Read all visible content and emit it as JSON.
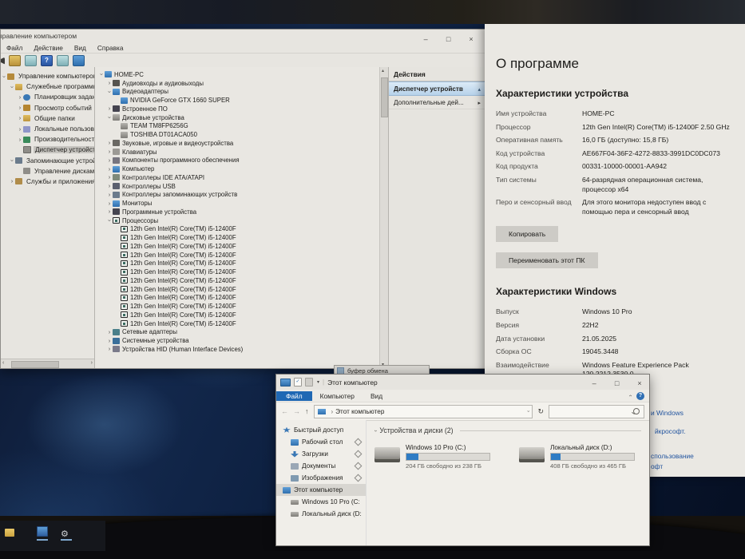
{
  "monitor": {
    "brand": "nulls"
  },
  "window_controls": {
    "minimize": "–",
    "maximize": "□",
    "close": "×"
  },
  "colors": {
    "accent": "#1f68b4",
    "link_blue": "#2456a0",
    "drive_bar": "#2f7cc4",
    "selection_blue": "#b7d2ea"
  },
  "computer_management": {
    "title": "Управление компьютером",
    "menus": [
      "Файл",
      "Действие",
      "Вид",
      "Справка"
    ],
    "left_tree": [
      {
        "icon": "console",
        "label": "Управление компьютером (л",
        "expander": "chevron-down",
        "indent": 0
      },
      {
        "icon": "folder-tools",
        "label": "Служебные программы",
        "expander": "chevron-down",
        "indent": 1
      },
      {
        "icon": "scheduler",
        "label": "Планировщик заданий",
        "expander": "chevron-right",
        "indent": 2
      },
      {
        "icon": "event-viewer",
        "label": "Просмотр событий",
        "expander": "chevron-right",
        "indent": 2
      },
      {
        "icon": "shared-folders",
        "label": "Общие папки",
        "expander": "chevron-right",
        "indent": 2
      },
      {
        "icon": "users",
        "label": "Локальные пользовать",
        "expander": "chevron-right",
        "indent": 2
      },
      {
        "icon": "performance",
        "label": "Производительность",
        "expander": "chevron-right",
        "indent": 2
      },
      {
        "icon": "device-manager",
        "label": "Диспетчер устройств",
        "expander": "none",
        "indent": 2,
        "selected": true
      },
      {
        "icon": "storage",
        "label": "Запоминающие устройст",
        "expander": "chevron-down",
        "indent": 1
      },
      {
        "icon": "disk-management",
        "label": "Управление дисками",
        "expander": "none",
        "indent": 2
      },
      {
        "icon": "services",
        "label": "Службы и приложения",
        "expander": "chevron-right",
        "indent": 1
      }
    ],
    "device_tree": [
      {
        "icon": "computer",
        "label": "HOME-PC",
        "expander": "chevron-down",
        "indent": 0
      },
      {
        "icon": "audio-inputs",
        "label": "Аудиовходы и аудиовыходы",
        "expander": "chevron-right",
        "indent": 1
      },
      {
        "icon": "display-adapter",
        "label": "Видеоадаптеры",
        "expander": "chevron-down",
        "indent": 1
      },
      {
        "icon": "display-adapter",
        "label": "NVIDIA GeForce GTX 1660 SUPER",
        "expander": "none",
        "indent": 2
      },
      {
        "icon": "firmware",
        "label": "Встроенное ПО",
        "expander": "chevron-right",
        "indent": 1
      },
      {
        "icon": "disk-drive",
        "label": "Дисковые устройства",
        "expander": "chevron-down",
        "indent": 1
      },
      {
        "icon": "disk-drive",
        "label": "TEAM TM8FP6256G",
        "expander": "none",
        "indent": 2
      },
      {
        "icon": "disk-drive",
        "label": "TOSHIBA DT01ACA050",
        "expander": "none",
        "indent": 2
      },
      {
        "icon": "sound-device",
        "label": "Звуковые, игровые и видеоустройства",
        "expander": "chevron-right",
        "indent": 1
      },
      {
        "icon": "keyboard",
        "label": "Клавиатуры",
        "expander": "chevron-right",
        "indent": 1
      },
      {
        "icon": "software-component",
        "label": "Компоненты программного обеспечения",
        "expander": "chevron-right",
        "indent": 1
      },
      {
        "icon": "computer",
        "label": "Компьютер",
        "expander": "chevron-right",
        "indent": 1
      },
      {
        "icon": "ide-controller",
        "label": "Контроллеры IDE ATA/ATAPI",
        "expander": "chevron-right",
        "indent": 1
      },
      {
        "icon": "usb-controller",
        "label": "Контроллеры USB",
        "expander": "chevron-right",
        "indent": 1
      },
      {
        "icon": "storage-controller",
        "label": "Контроллеры запоминающих устройств",
        "expander": "chevron-right",
        "indent": 1
      },
      {
        "icon": "monitor",
        "label": "Мониторы",
        "expander": "chevron-right",
        "indent": 1
      },
      {
        "icon": "software-device",
        "label": "Программные устройства",
        "expander": "chevron-right",
        "indent": 1
      },
      {
        "icon": "processor",
        "label": "Процессоры",
        "expander": "chevron-down",
        "indent": 1
      },
      {
        "icon": "processor",
        "label": "12th Gen Intel(R) Core(TM) i5-12400F",
        "expander": "none",
        "indent": 2
      },
      {
        "icon": "processor",
        "label": "12th Gen Intel(R) Core(TM) i5-12400F",
        "expander": "none",
        "indent": 2
      },
      {
        "icon": "processor",
        "label": "12th Gen Intel(R) Core(TM) i5-12400F",
        "expander": "none",
        "indent": 2
      },
      {
        "icon": "processor",
        "label": "12th Gen Intel(R) Core(TM) i5-12400F",
        "expander": "none",
        "indent": 2
      },
      {
        "icon": "processor",
        "label": "12th Gen Intel(R) Core(TM) i5-12400F",
        "expander": "none",
        "indent": 2
      },
      {
        "icon": "processor",
        "label": "12th Gen Intel(R) Core(TM) i5-12400F",
        "expander": "none",
        "indent": 2
      },
      {
        "icon": "processor",
        "label": "12th Gen Intel(R) Core(TM) i5-12400F",
        "expander": "none",
        "indent": 2
      },
      {
        "icon": "processor",
        "label": "12th Gen Intel(R) Core(TM) i5-12400F",
        "expander": "none",
        "indent": 2
      },
      {
        "icon": "processor",
        "label": "12th Gen Intel(R) Core(TM) i5-12400F",
        "expander": "none",
        "indent": 2
      },
      {
        "icon": "processor",
        "label": "12th Gen Intel(R) Core(TM) i5-12400F",
        "expander": "none",
        "indent": 2
      },
      {
        "icon": "processor",
        "label": "12th Gen Intel(R) Core(TM) i5-12400F",
        "expander": "none",
        "indent": 2
      },
      {
        "icon": "processor",
        "label": "12th Gen Intel(R) Core(TM) i5-12400F",
        "expander": "none",
        "indent": 2
      },
      {
        "icon": "network-adapter",
        "label": "Сетевые адаптеры",
        "expander": "chevron-right",
        "indent": 1
      },
      {
        "icon": "system-device",
        "label": "Системные устройства",
        "expander": "chevron-right",
        "indent": 1
      },
      {
        "icon": "hid-device",
        "label": "Устройства HID (Human Interface Devices)",
        "expander": "chevron-right",
        "indent": 1
      }
    ],
    "actions": {
      "header": "Действия",
      "items": [
        {
          "label": "Диспетчер устройств",
          "arrow": "up",
          "selected": true
        },
        {
          "label": "Дополнительные дей...",
          "arrow": "right"
        }
      ]
    }
  },
  "clipboard_strip": {
    "label": "буфер обмена"
  },
  "settings": {
    "page_title": "О программе",
    "device_section_title": "Характеристики устройства",
    "device_rows": [
      {
        "label": "Имя устройства",
        "value": "HOME-PC"
      },
      {
        "label": "Процессор",
        "value": "12th Gen Intel(R) Core(TM) i5-12400F   2.50 GHz"
      },
      {
        "label": "Оперативная память",
        "value": "16,0 ГБ (доступно: 15,8 ГБ)"
      },
      {
        "label": "Код устройства",
        "value": "AE667F04-36F2-4272-8833-3991DC0DC073"
      },
      {
        "label": "Код продукта",
        "value": "00331-10000-00001-AA942"
      },
      {
        "label": "Тип системы",
        "value": "64-разрядная операционная система, процессор x64"
      },
      {
        "label": "Перо и сенсорный ввод",
        "value": "Для этого монитора недоступен ввод с помощью пера и сенсорный ввод"
      }
    ],
    "copy_button": "Копировать",
    "rename_button": "Переименовать этот ПК",
    "windows_section_title": "Характеристики Windows",
    "windows_rows": [
      {
        "label": "Выпуск",
        "value": "Windows 10 Pro"
      },
      {
        "label": "Версия",
        "value": "22H2"
      },
      {
        "label": "Дата установки",
        "value": "21.05.2025"
      },
      {
        "label": "Сборка ОС",
        "value": "19045.3448"
      },
      {
        "label": "Взаимодействие",
        "value": "Windows Feature Experience Pack 120.2212.3530.0"
      }
    ],
    "link_fragments": [
      "и Windows",
      "йкрософт.",
      "спользование",
      "офт"
    ]
  },
  "explorer": {
    "title": "Этот компьютер",
    "ribbon_tabs": [
      {
        "label": "Файл",
        "active": true
      },
      {
        "label": "Компьютер",
        "active": false
      },
      {
        "label": "Вид",
        "active": false
      }
    ],
    "address": "Этот компьютер",
    "nav": [
      {
        "icon": "quick-access",
        "label": "Быстрый доступ",
        "indent": 0,
        "pinned": false
      },
      {
        "icon": "desktop",
        "label": "Рабочий стол",
        "indent": 1,
        "pinned": true
      },
      {
        "icon": "downloads",
        "label": "Загрузки",
        "indent": 1,
        "pinned": true
      },
      {
        "icon": "documents",
        "label": "Документы",
        "indent": 1,
        "pinned": true
      },
      {
        "icon": "pictures",
        "label": "Изображения",
        "indent": 1,
        "pinned": true
      },
      {
        "icon": "this-pc",
        "label": "Этот компьютер",
        "indent": 0,
        "selected": true
      },
      {
        "icon": "drive",
        "label": "Windows 10 Pro (C:",
        "indent": 1
      },
      {
        "icon": "drive",
        "label": "Локальный диск (D:",
        "indent": 1
      }
    ],
    "group_header": "Устройства и диски (2)",
    "drives": [
      {
        "name": "Windows 10 Pro (C:)",
        "free": "204 ГБ свободно из 238 ГБ",
        "used_pct": 14
      },
      {
        "name": "Локальный диск (D:)",
        "free": "408 ГБ свободно из 465 ГБ",
        "used_pct": 12
      }
    ]
  }
}
